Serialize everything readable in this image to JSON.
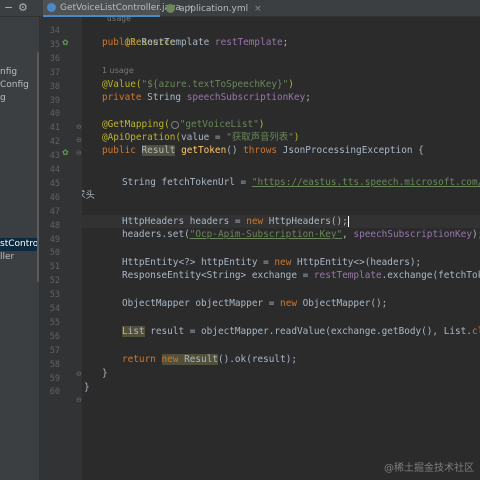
{
  "toolbar": {
    "icons": [
      "minus-icon",
      "gear-icon"
    ],
    "minus_glyph": "−",
    "gear_glyph": "⚙"
  },
  "tabs": [
    {
      "label": "GetVoiceListController.java",
      "icon_color": "#4a88c7",
      "active": true,
      "close": "×"
    },
    {
      "label": "application.yml",
      "icon_color": "#6a8759",
      "active": false,
      "close": "×"
    }
  ],
  "sidebar": {
    "items": [
      {
        "label": "nfig"
      },
      {
        "label": "Config"
      },
      {
        "label": "g"
      },
      {
        "label": "stControlle",
        "selected": true
      },
      {
        "label": "ller"
      }
    ]
  },
  "gutter": {
    "line_numbers": [
      "34",
      "35",
      "36",
      "37",
      "38",
      "39",
      "40",
      "41",
      "42",
      "43",
      "44",
      "45",
      "46",
      "47",
      "48",
      "49",
      "50",
      "51",
      "52",
      "53",
      "54",
      "55",
      "56",
      "57",
      "58",
      "59",
      "60"
    ]
  },
  "editor": {
    "partial_top": "\"usage\"",
    "resource_ann": "@Resource",
    "rest_decl": {
      "kw": "public",
      "type": "RestTemplate",
      "name": "restTemplate",
      "end": ";"
    },
    "usage_hint": "1 usage",
    "value_ann": {
      "ann": "@Value(",
      "str": "\"${azure.textToSpeechKey}\"",
      "end": ")"
    },
    "key_decl": {
      "kw": "private",
      "type": "String",
      "name": "speechSubscriptionKey",
      "end": ";"
    },
    "get_mapping": {
      "ann": "@GetMapping(",
      "str": "\"getVoiceList\"",
      "end": ")"
    },
    "api_op": {
      "ann": "@ApiOperation(",
      "param": "value = ",
      "str": "\"获取声音列表\"",
      "end": ")"
    },
    "method_sig": {
      "kw1": "public",
      "type": "Result",
      "name": "getToken",
      "rest": "() ",
      "kw2": "throws",
      "exc": " JsonProcessingException {"
    },
    "fetch_url": {
      "type": "String",
      "var": " fetchTokenUrl = ",
      "str": "\"https://eastus.tts.speech.microsoft.com/cognitiveservi"
    },
    "comment": "// 创建自定义请求头",
    "headers_decl": {
      "text": "HttpHeaders headers = ",
      "kw": "new",
      "rest": " HttpHeaders();"
    },
    "headers_set": {
      "pre": "headers.set(",
      "str": "\"Ocp-Apim-Subscription-Key\"",
      "mid": ", ",
      "field": "speechSubscriptionKey",
      "end": ");"
    },
    "entity_decl": {
      "text": "HttpEntity<?> httpEntity = ",
      "kw": "new",
      "rest": " HttpEntity<>(headers);"
    },
    "exchange_decl": {
      "text": "ResponseEntity<String> exchange = ",
      "field": "restTemplate",
      "rest": ".exchange(fetchTokenUrl, HttpMet"
    },
    "mapper_decl": {
      "text": "ObjectMapper objectMapper = ",
      "kw": "new",
      "rest": " ObjectMapper();"
    },
    "list_decl": {
      "type": "List",
      "text": " result = objectMapper.readValue(exchange.getBody(), List.",
      "kw": "class",
      "end": ");"
    },
    "return_stmt": {
      "kw": "return",
      "kw2": "new",
      "type": " Result",
      "rest": "().ok(result);"
    },
    "close_brace": "}",
    "close_brace2": "}"
  },
  "watermark": "@稀土掘金技术社区"
}
